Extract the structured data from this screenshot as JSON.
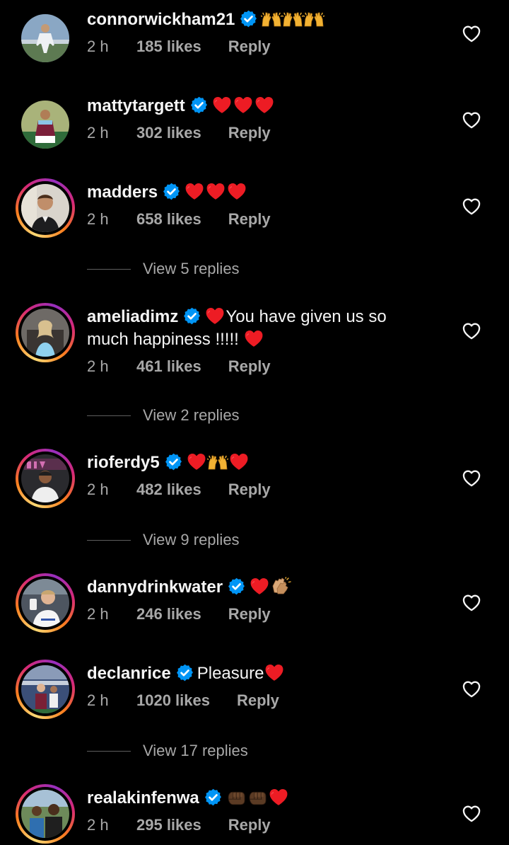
{
  "colors": {
    "background": "#000000",
    "text": "#f5f5f5",
    "secondary": "#a8a8a8",
    "verified": "#0095f6",
    "heart": "#ed1c24"
  },
  "icons": {
    "verified": "verified-badge-icon",
    "like": "heart-outline-icon"
  },
  "comments": [
    {
      "username": "connorwickham21",
      "text": "",
      "emojis": [
        "raising-hands",
        "raising-hands",
        "raising-hands"
      ],
      "time": "2 h",
      "likes": "185 likes",
      "reply": "Reply"
    },
    {
      "username": "mattytargett",
      "text": "",
      "emojis": [
        "red-heart",
        "red-heart",
        "red-heart"
      ],
      "time": "2 h",
      "likes": "302 likes",
      "reply": "Reply"
    },
    {
      "username": "madders",
      "text": "",
      "emojis": [
        "red-heart",
        "red-heart",
        "red-heart"
      ],
      "time": "2 h",
      "likes": "658 likes",
      "reply": "Reply",
      "view_replies": "View 5 replies"
    },
    {
      "username": "ameliadimz",
      "text": "You have given us so much happiness !!!!!",
      "time": "2 h",
      "likes": "461 likes",
      "reply": "Reply",
      "view_replies": "View 2 replies"
    },
    {
      "username": "rioferdy5",
      "text": "",
      "emojis": [
        "red-heart",
        "raising-hands",
        "red-heart"
      ],
      "time": "2 h",
      "likes": "482 likes",
      "reply": "Reply",
      "view_replies": "View 9 replies"
    },
    {
      "username": "dannydrinkwater",
      "text": "",
      "emojis": [
        "red-heart",
        "clapping-hands"
      ],
      "time": "2 h",
      "likes": "246 likes",
      "reply": "Reply"
    },
    {
      "username": "declanrice",
      "text": "Pleasure",
      "emojis": [
        "red-heart"
      ],
      "time": "2 h",
      "likes": "1020 likes",
      "reply": "Reply",
      "view_replies": "View 17 replies"
    },
    {
      "username": "realakinfenwa",
      "text": "",
      "emojis": [
        "fist",
        "fist",
        "red-heart"
      ],
      "time": "2 h",
      "likes": "295 likes",
      "reply": "Reply"
    }
  ]
}
